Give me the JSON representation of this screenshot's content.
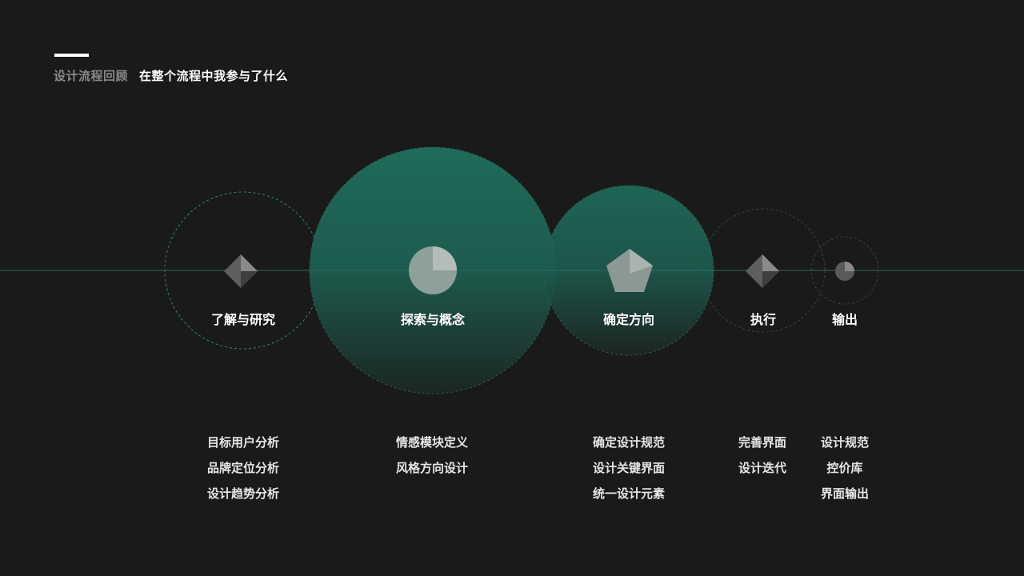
{
  "header": {
    "label": "设计流程回顾",
    "title": "在整个流程中我参与了什么"
  },
  "colors": {
    "background": "#1a1a1a",
    "accent": "#1f6b5a",
    "line": "#2f6b5e",
    "text": "#ffffff",
    "muted": "#8a8a8a"
  },
  "stages": [
    {
      "id": "research",
      "label": "了解与研究",
      "icon": "diamond-icon",
      "emphasis": "outline"
    },
    {
      "id": "explore",
      "label": "探索与概念",
      "icon": "pie-icon",
      "emphasis": "filled"
    },
    {
      "id": "direction",
      "label": "确定方向",
      "icon": "pentagon-icon",
      "emphasis": "filled"
    },
    {
      "id": "execute",
      "label": "执行",
      "icon": "diamond-icon",
      "emphasis": "outline"
    },
    {
      "id": "output",
      "label": "输出",
      "icon": "circle-icon",
      "emphasis": "outline"
    }
  ],
  "tasks": [
    [
      "目标用户分析",
      "品牌定位分析",
      "设计趋势分析"
    ],
    [
      "情感模块定义",
      "风格方向设计"
    ],
    [
      "确定设计规范",
      "设计关键界面",
      "统一设计元素"
    ],
    [
      "完善界面",
      "设计迭代"
    ],
    [
      "设计规范",
      "控价库",
      "界面输出"
    ]
  ]
}
